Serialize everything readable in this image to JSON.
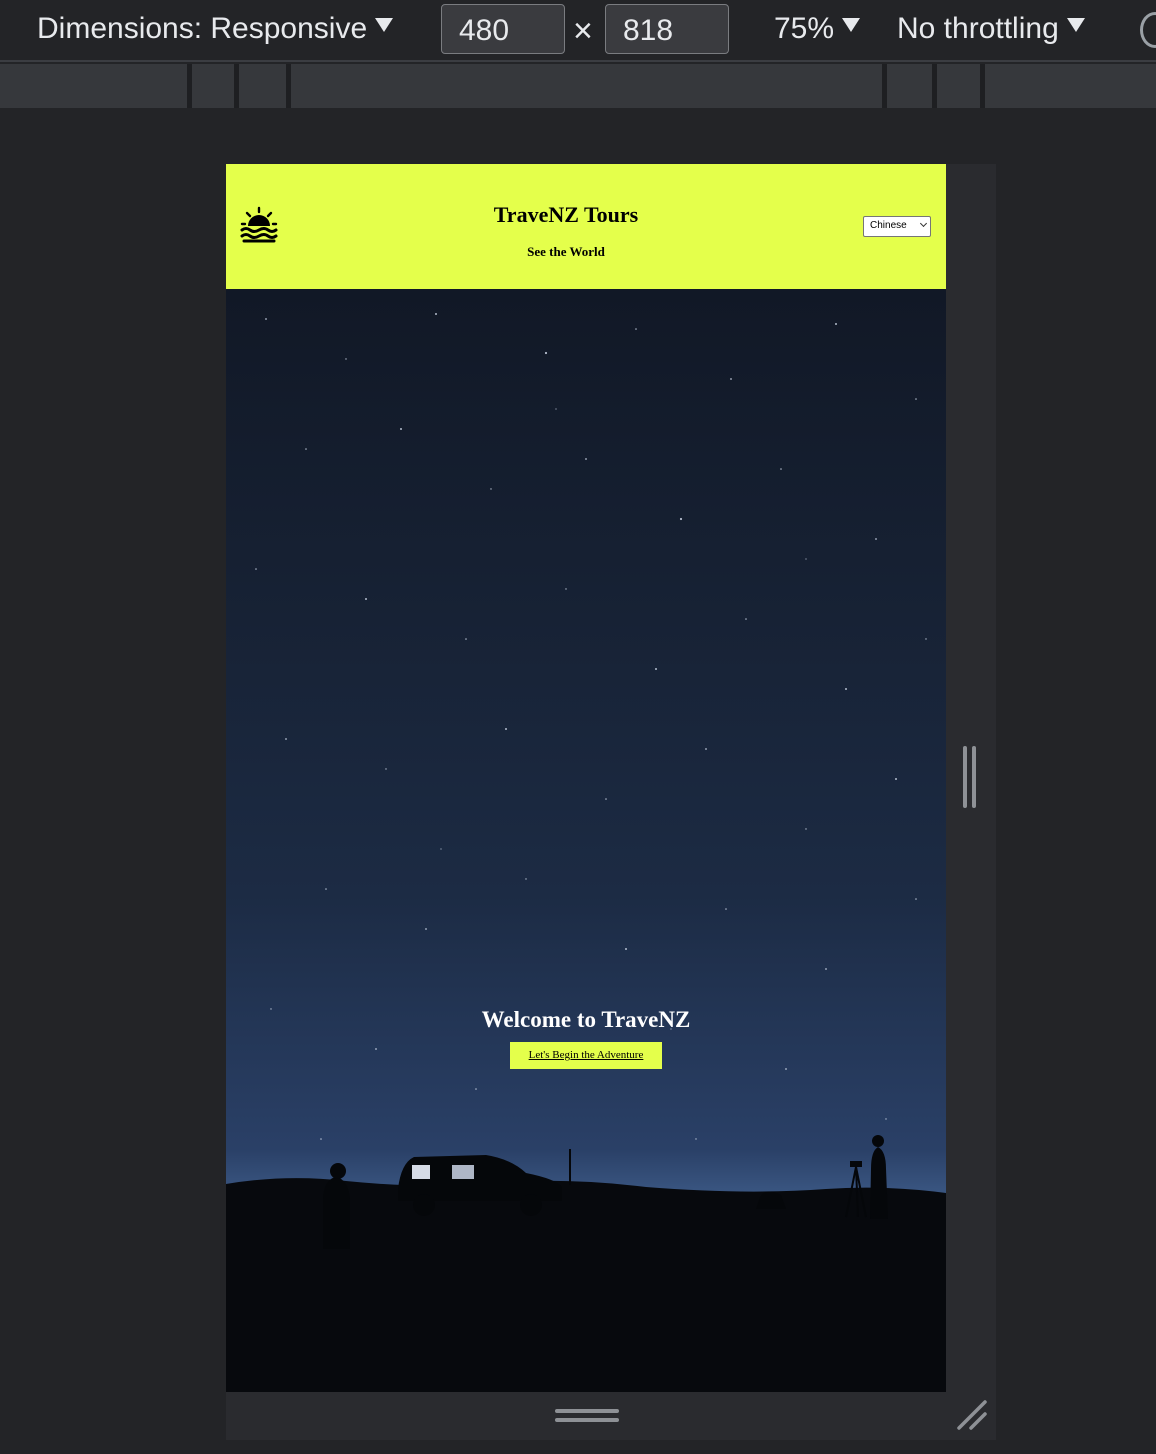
{
  "devtools": {
    "dimensions_label": "Dimensions: Responsive",
    "width_value": "480",
    "times": "×",
    "height_value": "818",
    "zoom": "75%",
    "throttling": "No throttling"
  },
  "site": {
    "title": "TraveNZ Tours",
    "subtitle": "See the World",
    "language_selected": "Chinese",
    "logo_icon": "sunset-icon",
    "header_color": "#e4ff4b"
  },
  "hero": {
    "title": "Welcome to TraveNZ",
    "button_label": "Let's Begin the Adventure"
  }
}
